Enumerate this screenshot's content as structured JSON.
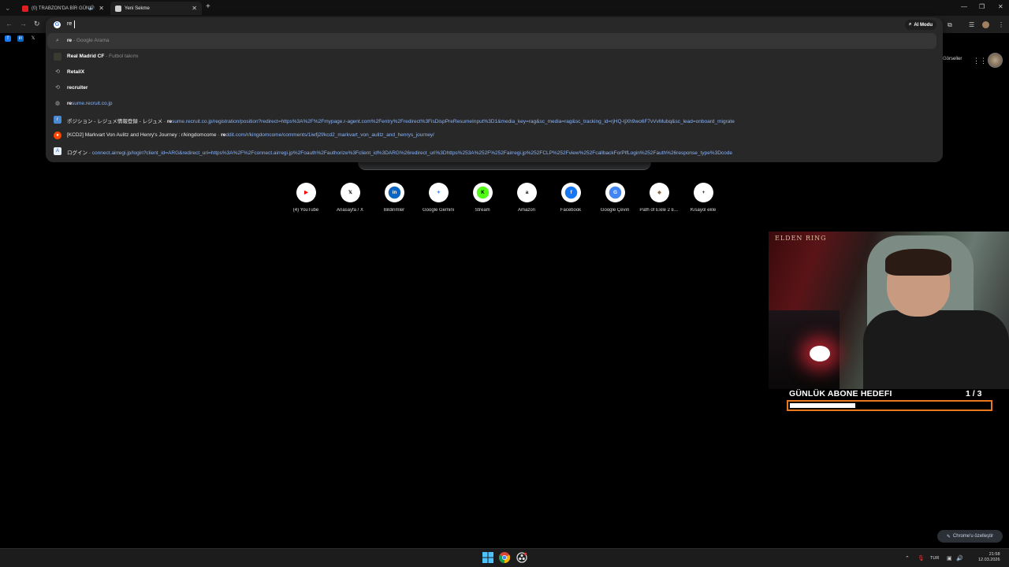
{
  "tabs": [
    {
      "title": "(0) TRABZON'DA BİR GÜN!",
      "favicon_color": "#e02020",
      "audio": true
    },
    {
      "title": "Yeni Sekme",
      "favicon_color": "#d0d0d0",
      "active": true
    }
  ],
  "omnibox": {
    "typed": "re",
    "ai_mode_label": "AI Modu",
    "suggestions": [
      {
        "icon": "search-icon",
        "bold": "re",
        "rest": "",
        "sep": " - ",
        "detail": "Google Arama",
        "detail_type": "gray",
        "selected": true
      },
      {
        "icon": "real-madrid-icon",
        "bold": "Re",
        "rest": "al Madrid CF",
        "sep": " - ",
        "detail": "Futbol takımı",
        "detail_type": "gray"
      },
      {
        "icon": "history-icon",
        "bold": "Re",
        "rest": "tailX",
        "sep": "",
        "detail": "",
        "detail_type": "gray"
      },
      {
        "icon": "history-icon",
        "bold": "re",
        "rest": "cruiter",
        "sep": "",
        "detail": "",
        "detail_type": "gray"
      },
      {
        "icon": "globe-icon",
        "bold": "re",
        "rest": "sume.recruit.co.jp",
        "sep": "",
        "detail": "",
        "detail_type": "url",
        "link_style": true
      },
      {
        "icon": "resume-icon",
        "title": "ポジション - レジュメ情報登録 - レジュメ",
        "sep": " - ",
        "detail_bold": "re",
        "detail": "sume.recruit.co.jp/registration/position?redirect=https%3A%2F%2Fmypage.r-agent.com%2Fentry%2Fredirect%3FisDispPreResumeInput%3D1&media_key=rag&sc_media=rag&sc_tracking_id=rjHQ-tjXh9wo6F7vVvMubq&sc_lead=onboard_migrate",
        "detail_type": "url"
      },
      {
        "icon": "reddit-icon",
        "title": "[KCD2] Markvart Von Aulitz and Henry's Journey : r/kingdomcome",
        "sep": " - ",
        "detail_bold": "re",
        "detail": "ddit.com/r/kingdomcome/comments/1iwfj2f/kcd2_markvart_von_aulitz_and_henrys_journey/",
        "detail_type": "url"
      },
      {
        "icon": "airregi-icon",
        "title": "ログイン",
        "sep": " - ",
        "detail_bold": "",
        "detail": "connect.airregi.jp/login?client_id=ARG&redirect_uri=https%3A%2F%2Fconnect.airregi.jp%2Foauth%2Fauthorize%3Fclient_id%3DARG%26redirect_uri%3Dhttps%253A%252F%252Fairregi.jp%252FCLP%252Fview%252FcallbackForPlfLogin%252Fauth%26response_type%3Dcode",
        "detail_type": "url"
      }
    ]
  },
  "header_right": {
    "images_label": "Görseller"
  },
  "shortcuts": [
    {
      "label": "(4) YouTube",
      "glyph": "▶",
      "color": "#ff0000",
      "bg": "#ffffff"
    },
    {
      "label": "Anasayfa / X",
      "glyph": "𝕏",
      "color": "#000000",
      "bg": "#ffffff"
    },
    {
      "label": "Bildirimler",
      "glyph": "in",
      "color": "#ffffff",
      "bg": "#0a66c2"
    },
    {
      "label": "Google Gemini",
      "glyph": "✦",
      "color": "#4a90e2",
      "bg": "#ffffff"
    },
    {
      "label": "Stream",
      "glyph": "K",
      "color": "#000000",
      "bg": "#53fc18"
    },
    {
      "label": "Amazon",
      "glyph": "a",
      "color": "#000000",
      "bg": "#ffffff"
    },
    {
      "label": "Facebook",
      "glyph": "f",
      "color": "#ffffff",
      "bg": "#1877f2"
    },
    {
      "label": "Google Çeviri",
      "glyph": "G",
      "color": "#ffffff",
      "bg": "#4285f4"
    },
    {
      "label": "Path of Exile 2 E...",
      "glyph": "◆",
      "color": "#8a6a3a",
      "bg": "#ffffff"
    },
    {
      "label": "Kısayol ekle",
      "glyph": "+",
      "color": "#202124",
      "bg": "#ffffff"
    }
  ],
  "overlay": {
    "game_logo": "ELDEN RING",
    "goal_title": "GÜNLÜK ABONE HEDEFI",
    "goal_count": "1 / 3",
    "goal_progress": 0.33,
    "accent": "#e8791e"
  },
  "customize_label": "Chrome'u özelleştir",
  "taskbar": {
    "lang": "TUR",
    "time": "21:58",
    "date": "12.03.2026"
  }
}
